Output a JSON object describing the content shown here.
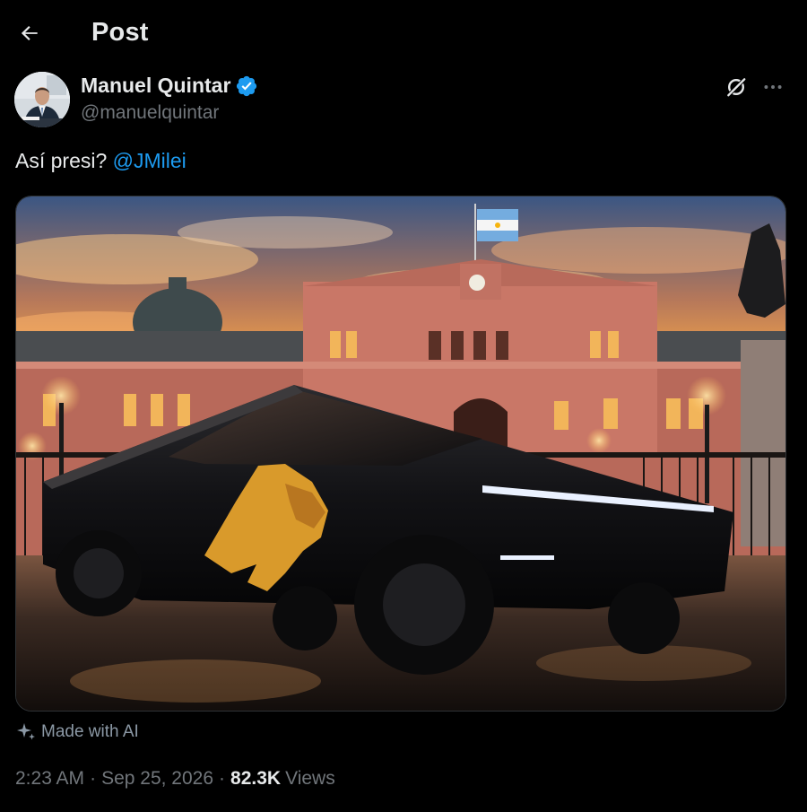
{
  "header": {
    "title": "Post",
    "back_icon": "arrow-left-icon"
  },
  "author": {
    "name": "Manuel Quintar",
    "handle": "@manuelquintar",
    "verified": true,
    "verified_color": "#1d9bf0"
  },
  "actions": {
    "grok_icon": "grok-icon",
    "more_icon": "more-horizontal-icon"
  },
  "tweet": {
    "text": "Así presi?",
    "mention": "@JMilei"
  },
  "media": {
    "type": "image"
  },
  "ai_label": {
    "text": "Made with AI",
    "icon": "sparkle-icon"
  },
  "meta": {
    "time": "2:23 AM",
    "date": "Sep 25, 2026",
    "views_count": "82.3K",
    "views_label": "Views"
  },
  "colors": {
    "background": "#000000",
    "text_primary": "#e7e9ea",
    "text_secondary": "#71767b",
    "accent": "#1d9bf0"
  }
}
